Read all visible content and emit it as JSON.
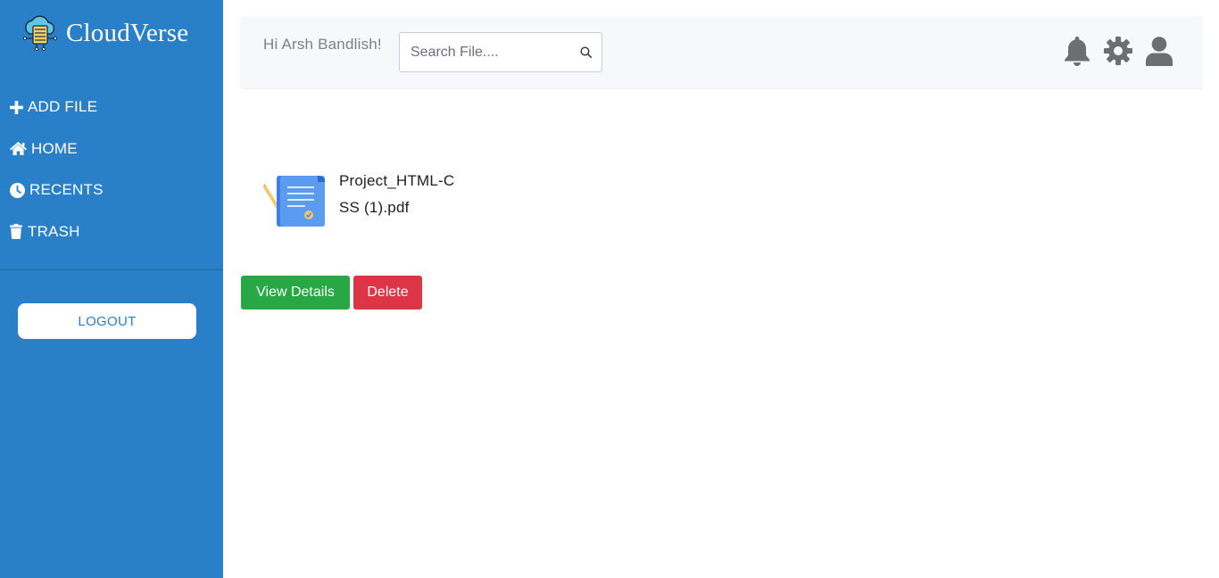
{
  "app": {
    "brand_name": "CloudVerse"
  },
  "sidebar": {
    "items": [
      {
        "label": "ADD FILE",
        "icon": "plus-icon"
      },
      {
        "label": "HOME",
        "icon": "home-icon"
      },
      {
        "label": "RECENTS",
        "icon": "clock-icon"
      },
      {
        "label": "TRASH",
        "icon": "trash-icon"
      }
    ],
    "logout_label": "LOGOUT"
  },
  "header": {
    "greeting": "Hi Arsh Bandlish!",
    "search_placeholder": "Search File....",
    "icons": [
      "bell-icon",
      "gear-icon",
      "user-icon"
    ]
  },
  "file": {
    "name": "Project_HTML-CSS (1).pdf",
    "icon": "document-icon"
  },
  "actions": {
    "view_label": "View Details",
    "delete_label": "Delete"
  },
  "colors": {
    "sidebar": "#2a80c8",
    "view_button": "#28a745",
    "delete_button": "#dc3545",
    "header_icons": "#6c6f72"
  }
}
